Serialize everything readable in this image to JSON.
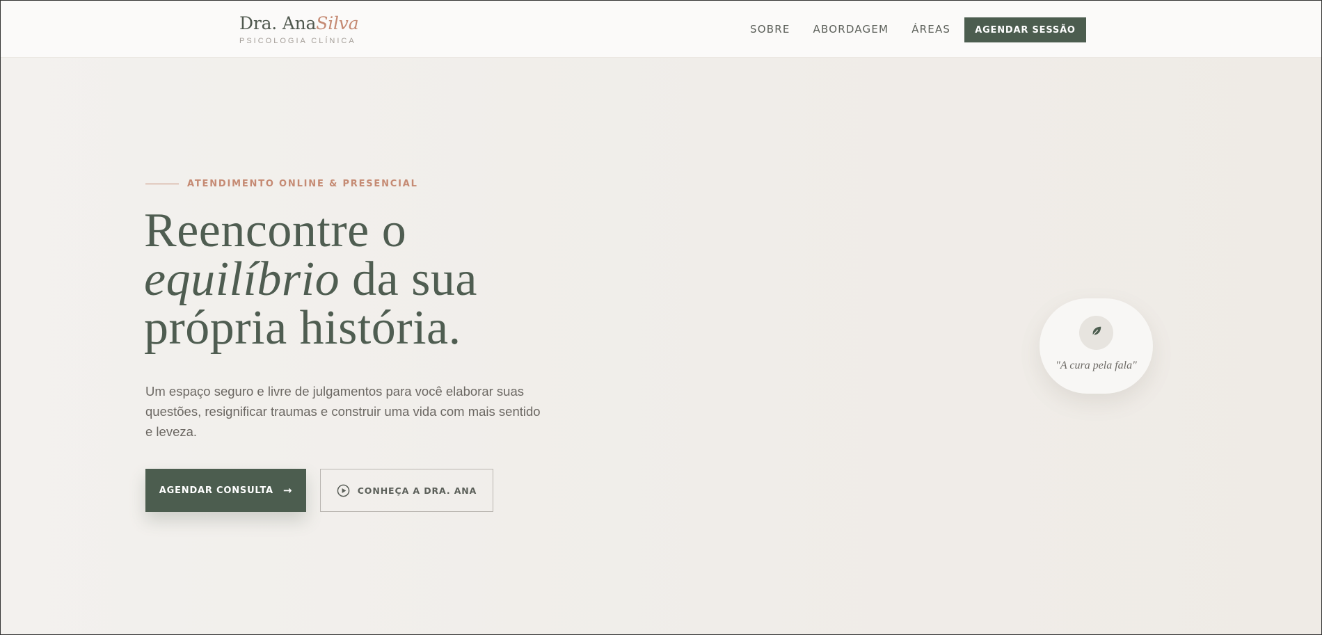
{
  "brand": {
    "name_regular": "Dra. Ana",
    "name_accent": "Silva",
    "subtitle": "PSICOLOGIA CLÍNICA"
  },
  "nav": {
    "links": [
      "SOBRE",
      "ABORDAGEM",
      "ÁREAS"
    ],
    "cta_label": "AGENDAR SESSÃO"
  },
  "hero": {
    "eyebrow": "ATENDIMENTO ONLINE & PRESENCIAL",
    "headline": {
      "line1": "Reencontre o",
      "line2_italic": "equilíbrio",
      "line2_rest": " da sua",
      "line3": "própria história."
    },
    "lead": "Um espaço seguro e livre de julgamentos para você elaborar suas questões, resignificar traumas e construir uma vida com mais sentido e leveza.",
    "primary_button": "AGENDAR CONSULTA",
    "secondary_button": "CONHEÇA A DRA. ANA"
  },
  "quote": {
    "text": "\"A cura pela fala\"",
    "icon": "leaf-icon"
  },
  "icons": {
    "arrow": "arrow-right-icon",
    "play": "play-circle-icon"
  },
  "colors": {
    "primary": "#4c5d4f",
    "accent": "#c58a73",
    "background": "#f1eeea",
    "text": "#6b6762"
  }
}
